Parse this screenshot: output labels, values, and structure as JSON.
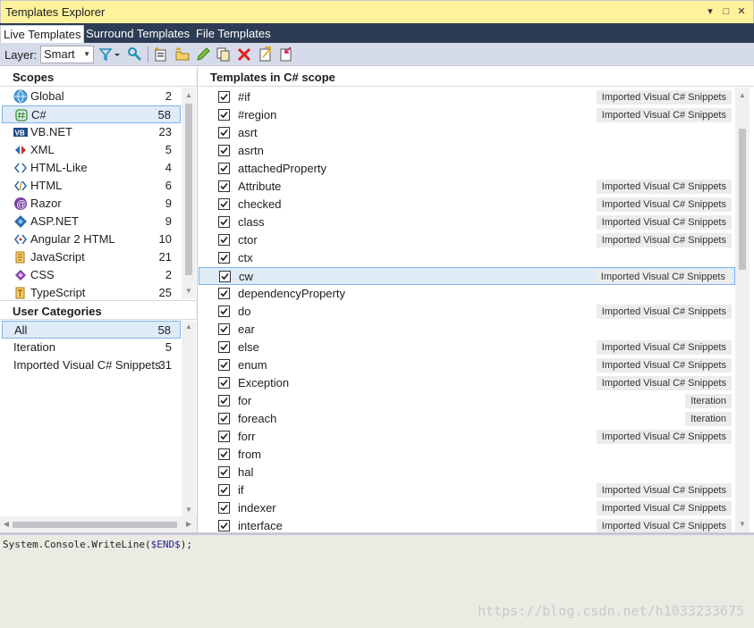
{
  "window": {
    "title": "Templates Explorer",
    "controls": [
      "▾",
      "□",
      "✕"
    ]
  },
  "tabs": [
    {
      "label": "Live Templates",
      "active": true
    },
    {
      "label": "Surround Templates",
      "active": false
    },
    {
      "label": "File Templates",
      "active": false
    }
  ],
  "toolbar": {
    "layer_label": "Layer:",
    "layer_value": "Smart",
    "icons": [
      "filter-icon",
      "wrench-icon",
      "new-template-icon",
      "new-folder-icon",
      "edit-icon",
      "copy-icon",
      "delete-icon",
      "export-icon",
      "import-icon"
    ]
  },
  "scopes": {
    "header": "Scopes",
    "items": [
      {
        "name": "Global",
        "count": "2",
        "icon": "globe-icon"
      },
      {
        "name": "C#",
        "count": "58",
        "icon": "csharp-icon",
        "selected": true
      },
      {
        "name": "VB.NET",
        "count": "23",
        "icon": "vbnet-icon"
      },
      {
        "name": "XML",
        "count": "5",
        "icon": "xml-icon"
      },
      {
        "name": "HTML-Like",
        "count": "4",
        "icon": "html-like-icon"
      },
      {
        "name": "HTML",
        "count": "6",
        "icon": "html-icon"
      },
      {
        "name": "Razor",
        "count": "9",
        "icon": "razor-icon"
      },
      {
        "name": "ASP.NET",
        "count": "9",
        "icon": "aspnet-icon"
      },
      {
        "name": "Angular 2 HTML",
        "count": "10",
        "icon": "angular-icon"
      },
      {
        "name": "JavaScript",
        "count": "21",
        "icon": "javascript-icon"
      },
      {
        "name": "CSS",
        "count": "2",
        "icon": "css-icon"
      },
      {
        "name": "TypeScript",
        "count": "25",
        "icon": "typescript-icon"
      }
    ]
  },
  "categories": {
    "header": "User Categories",
    "items": [
      {
        "name": "All",
        "count": "58",
        "selected": true
      },
      {
        "name": "Iteration",
        "count": "5"
      },
      {
        "name": "Imported Visual C# Snippets",
        "count": "31"
      }
    ]
  },
  "templates": {
    "header": "Templates in C# scope",
    "items": [
      {
        "name": "#if",
        "category": "Imported Visual C# Snippets"
      },
      {
        "name": "#region",
        "category": "Imported Visual C# Snippets"
      },
      {
        "name": "asrt",
        "category": ""
      },
      {
        "name": "asrtn",
        "category": ""
      },
      {
        "name": "attachedProperty",
        "category": ""
      },
      {
        "name": "Attribute",
        "category": "Imported Visual C# Snippets"
      },
      {
        "name": "checked",
        "category": "Imported Visual C# Snippets"
      },
      {
        "name": "class",
        "category": "Imported Visual C# Snippets"
      },
      {
        "name": "ctor",
        "category": "Imported Visual C# Snippets"
      },
      {
        "name": "ctx",
        "category": ""
      },
      {
        "name": "cw",
        "category": "Imported Visual C# Snippets",
        "selected": true
      },
      {
        "name": "dependencyProperty",
        "category": ""
      },
      {
        "name": "do",
        "category": "Imported Visual C# Snippets"
      },
      {
        "name": "ear",
        "category": ""
      },
      {
        "name": "else",
        "category": "Imported Visual C# Snippets"
      },
      {
        "name": "enum",
        "category": "Imported Visual C# Snippets"
      },
      {
        "name": "Exception",
        "category": "Imported Visual C# Snippets"
      },
      {
        "name": "for",
        "category": "Iteration"
      },
      {
        "name": "foreach",
        "category": "Iteration"
      },
      {
        "name": "forr",
        "category": "Imported Visual C# Snippets"
      },
      {
        "name": "from",
        "category": ""
      },
      {
        "name": "hal",
        "category": ""
      },
      {
        "name": "if",
        "category": "Imported Visual C# Snippets"
      },
      {
        "name": "indexer",
        "category": "Imported Visual C# Snippets"
      },
      {
        "name": "interface",
        "category": "Imported Visual C# Snippets"
      }
    ]
  },
  "editor": {
    "code_prefix": "System.Console.WriteLine(",
    "code_var": "$END$",
    "code_suffix": ");"
  },
  "watermark": "https://blog.csdn.net/h1033233675"
}
